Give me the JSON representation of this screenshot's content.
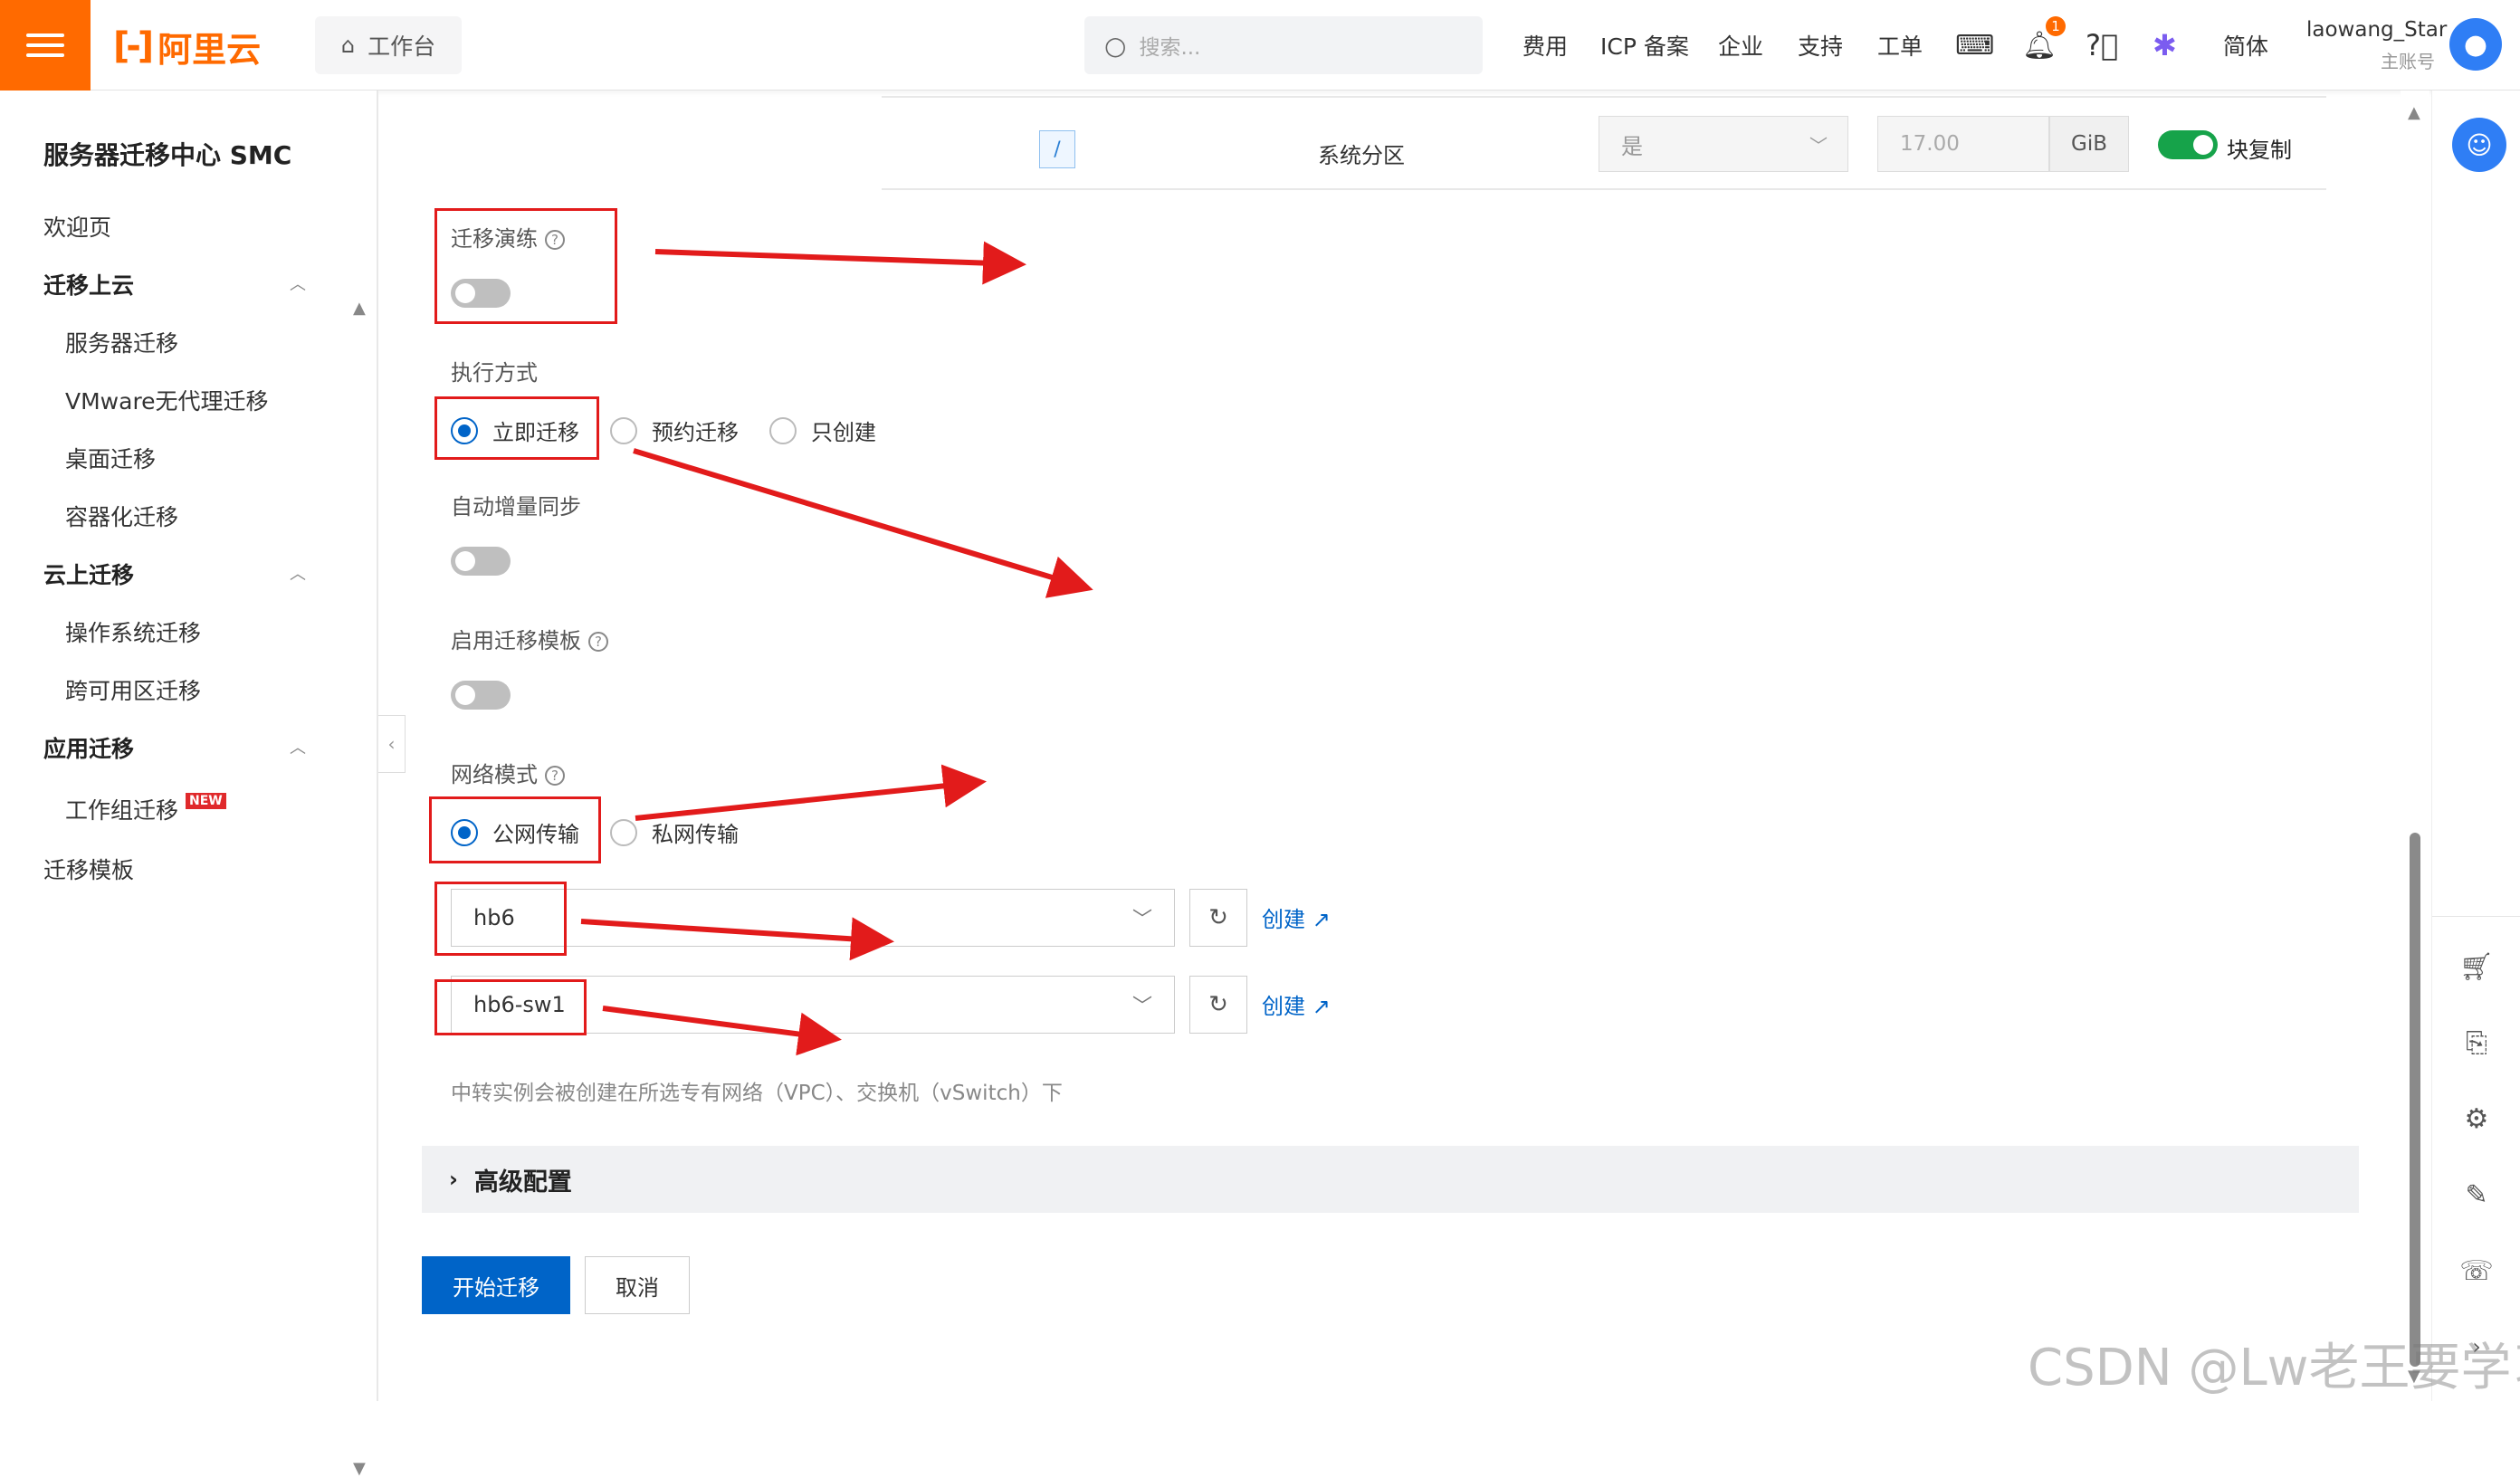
{
  "topbar": {
    "logo_text": "阿里云",
    "workbench": "工作台",
    "search_placeholder": "搜索...",
    "nav": [
      "费用",
      "ICP 备案",
      "企业",
      "支持",
      "工单"
    ],
    "notification_count": "1",
    "lang": "简体",
    "username": "laowang_Star",
    "account_type": "主账号"
  },
  "sidebar": {
    "title": "服务器迁移中心 SMC",
    "welcome": "欢迎页",
    "group1": "迁移上云",
    "g1_items": [
      "服务器迁移",
      "VMware无代理迁移",
      "桌面迁移",
      "容器化迁移"
    ],
    "group2": "云上迁移",
    "g2_items": [
      "操作系统迁移",
      "跨可用区迁移"
    ],
    "group3": "应用迁移",
    "g3_item": "工作组迁移",
    "new_badge": "NEW",
    "template": "迁移模板"
  },
  "disk_row": {
    "path": "/",
    "partition": "系统分区",
    "select_value": "是",
    "size": "17.00",
    "unit": "GiB",
    "block_copy": "块复制",
    "block_copy_enabled": true
  },
  "form": {
    "drill_label": "迁移演练",
    "drill_enabled": false,
    "exec_label": "执行方式",
    "exec_options": [
      "立即迁移",
      "预约迁移",
      "只创建"
    ],
    "exec_selected": "立即迁移",
    "auto_sync_label": "自动增量同步",
    "auto_sync_enabled": false,
    "template_label": "启用迁移模板",
    "template_enabled": false,
    "network_label": "网络模式",
    "network_options": [
      "公网传输",
      "私网传输"
    ],
    "network_selected": "公网传输",
    "vpc_value": "hb6",
    "vswitch_value": "hb6-sw1",
    "create_label": "创建",
    "hint": "中转实例会被创建在所选专有网络（VPC）、交换机（vSwitch）下",
    "advanced": "高级配置",
    "start_button": "开始迁移",
    "cancel_button": "取消"
  },
  "watermark": "CSDN @Lw老王要学习",
  "colors": {
    "brand": "#ff6a00",
    "primary": "#0064c8",
    "annotation": "#e21b1b",
    "toggle_on": "#16a34a"
  }
}
